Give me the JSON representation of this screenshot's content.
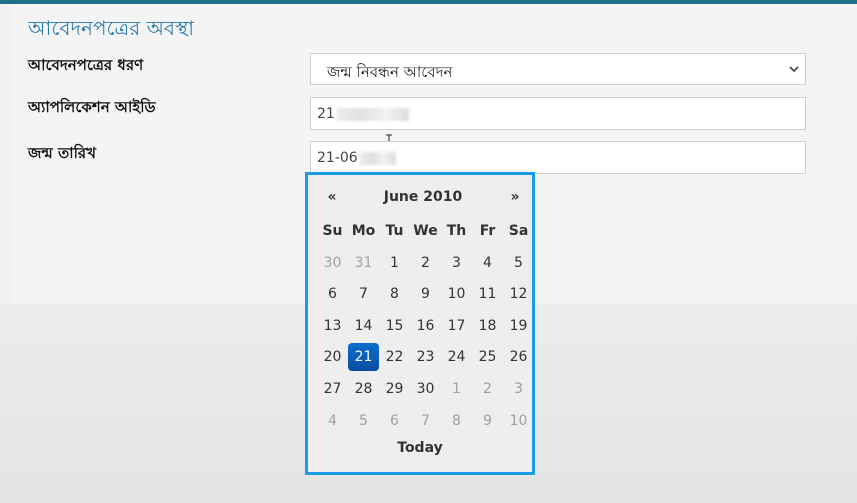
{
  "section": {
    "title": "আবেদনপত্রের অবস্থা"
  },
  "fields": {
    "type_label": "আবেদনপত্রের ধরণ",
    "type_value": "জন্ম নিবন্ধন আবেদন",
    "app_id_label": "অ্যাপলিকেশন আইডি",
    "app_id_value": "21",
    "dob_label": "জন্ম তারিখ",
    "dob_value": "21-06"
  },
  "calendar": {
    "prev": "«",
    "next": "»",
    "title": "June 2010",
    "today": "Today",
    "weekdays": [
      "Su",
      "Mo",
      "Tu",
      "We",
      "Th",
      "Fr",
      "Sa"
    ],
    "weeks": [
      [
        {
          "d": "30",
          "o": true
        },
        {
          "d": "31",
          "o": true
        },
        {
          "d": "1"
        },
        {
          "d": "2"
        },
        {
          "d": "3"
        },
        {
          "d": "4"
        },
        {
          "d": "5"
        }
      ],
      [
        {
          "d": "6"
        },
        {
          "d": "7"
        },
        {
          "d": "8"
        },
        {
          "d": "9"
        },
        {
          "d": "10"
        },
        {
          "d": "11"
        },
        {
          "d": "12"
        }
      ],
      [
        {
          "d": "13"
        },
        {
          "d": "14"
        },
        {
          "d": "15"
        },
        {
          "d": "16"
        },
        {
          "d": "17"
        },
        {
          "d": "18"
        },
        {
          "d": "19"
        }
      ],
      [
        {
          "d": "20"
        },
        {
          "d": "21",
          "a": true
        },
        {
          "d": "22"
        },
        {
          "d": "23"
        },
        {
          "d": "24"
        },
        {
          "d": "25"
        },
        {
          "d": "26"
        }
      ],
      [
        {
          "d": "27"
        },
        {
          "d": "28"
        },
        {
          "d": "29"
        },
        {
          "d": "30"
        },
        {
          "d": "1",
          "o": true
        },
        {
          "d": "2",
          "o": true
        },
        {
          "d": "3",
          "o": true
        }
      ],
      [
        {
          "d": "4",
          "o": true
        },
        {
          "d": "5",
          "o": true
        },
        {
          "d": "6",
          "o": true
        },
        {
          "d": "7",
          "o": true
        },
        {
          "d": "8",
          "o": true
        },
        {
          "d": "9",
          "o": true
        },
        {
          "d": "10",
          "o": true
        }
      ]
    ]
  },
  "colors": {
    "accent": "#1a9be6",
    "title": "#2a7ab0",
    "selected": "#0d6fd0"
  }
}
